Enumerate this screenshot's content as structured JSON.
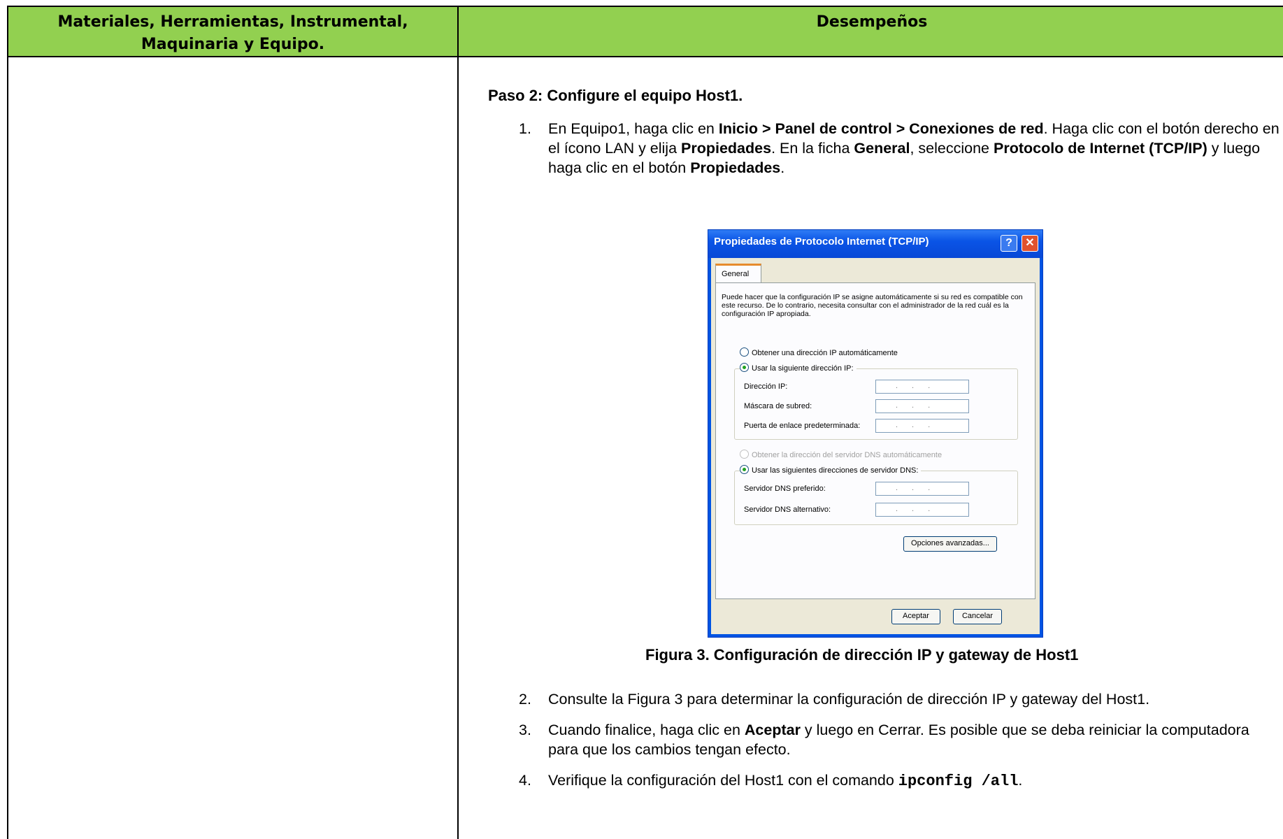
{
  "table": {
    "col1_header": "Materiales, Herramientas, Instrumental, Maquinaria y Equipo.",
    "col2_header": "Desempeños"
  },
  "content": {
    "step_title": "Paso 2: Configure el equipo Host1.",
    "item1": {
      "num": "1.",
      "t1": "En Equipo1, haga clic en ",
      "b1": "Inicio > Panel de control > Conexiones de red",
      "t2": ". Haga clic con el botón derecho en el ícono LAN y elija ",
      "b2": "Propiedades",
      "t3": ". En la ficha ",
      "b3": "General",
      "t4": ", seleccione ",
      "b4": "Protocolo de Internet (TCP/IP)",
      "t5": " y luego haga clic en el botón ",
      "b5": "Propiedades",
      "t6": "."
    },
    "figure_caption": "Figura 3. Configuración de dirección IP y gateway de Host1",
    "item2": {
      "num": "2.",
      "text": "Consulte la Figura 3 para determinar la configuración de dirección IP y gateway del Host1."
    },
    "item3": {
      "num": "3.",
      "t1": "Cuando finalice, haga clic en ",
      "b1": "Aceptar",
      "t2": " y luego en Cerrar. Es posible que se deba reiniciar la computadora para que los cambios tengan efecto."
    },
    "item4": {
      "num": "4.",
      "t1": "Verifique la configuración del Host1 con el comando ",
      "code": "ipconfig /all",
      "t2": "."
    }
  },
  "dialog": {
    "title": "Propiedades de Protocolo Internet (TCP/IP)",
    "help_glyph": "?",
    "close_glyph": "✕",
    "tab_general": "General",
    "description": "Puede hacer que la configuración IP se asigne automáticamente si su red es compatible con este recurso. De lo contrario, necesita consultar con el administrador de la red cuál es la configuración IP apropiada.",
    "radio_auto_ip": "Obtener una dirección IP automáticamente",
    "radio_manual_ip": "Usar la siguiente dirección IP:",
    "label_ip": "Dirección IP:",
    "label_mask": "Máscara de subred:",
    "label_gateway": "Puerta de enlace predeterminada:",
    "radio_auto_dns": "Obtener la dirección del servidor DNS automáticamente",
    "radio_manual_dns": "Usar las siguientes direcciones de servidor DNS:",
    "label_dns_pref": "Servidor DNS preferido:",
    "label_dns_alt": "Servidor DNS alternativo:",
    "ip_placeholder": "...",
    "btn_advanced": "Opciones avanzadas...",
    "btn_ok": "Aceptar",
    "btn_cancel": "Cancelar"
  }
}
